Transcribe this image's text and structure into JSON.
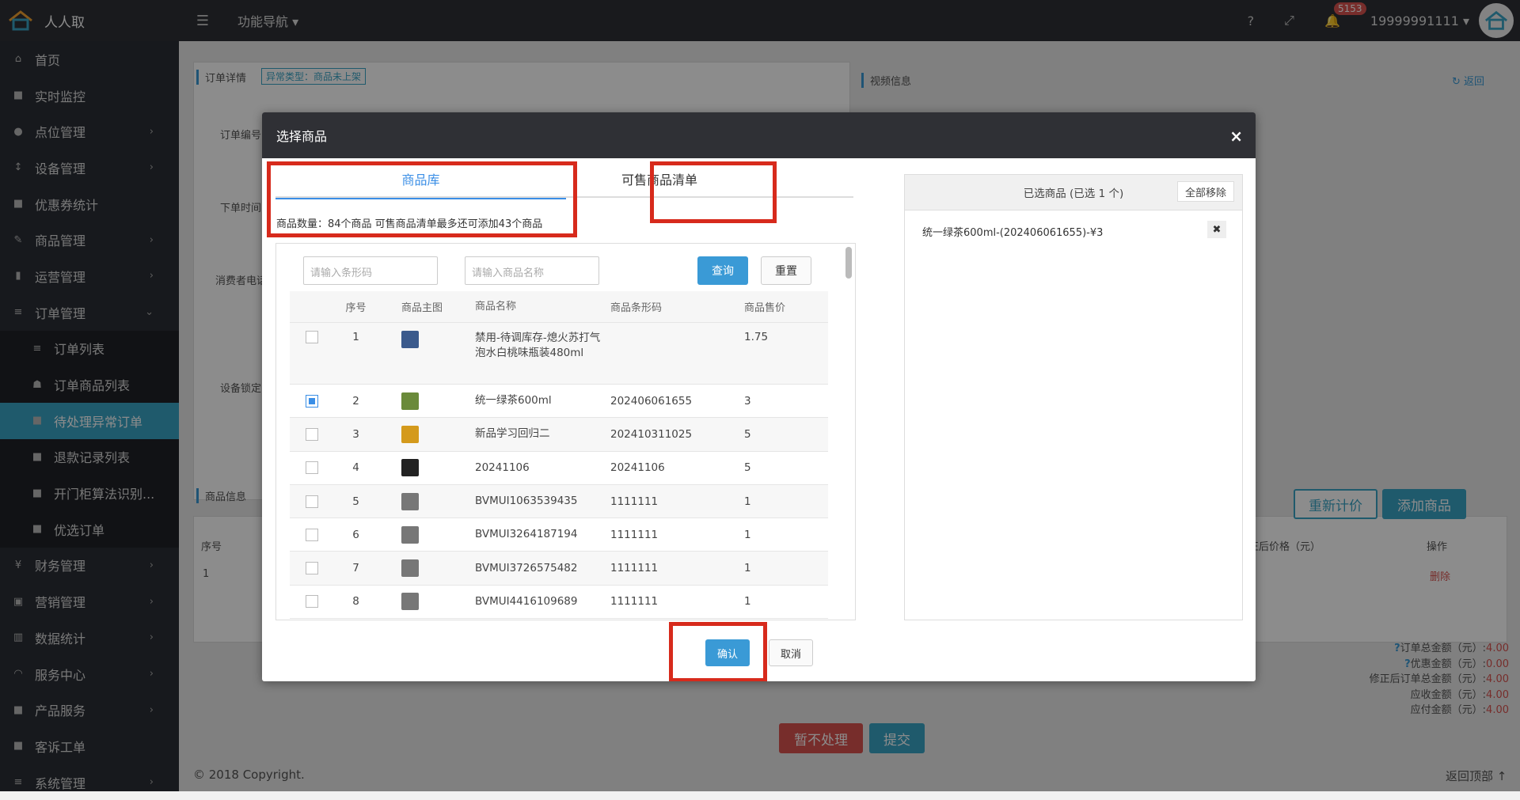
{
  "app": {
    "name": "人人取",
    "func_nav": "功能导航",
    "notify_count": "5153",
    "user": "19999991111",
    "help": "?",
    "expand": "⤢"
  },
  "sidebar": {
    "items": [
      {
        "label": "首页",
        "icon": "home-icon",
        "chev": false
      },
      {
        "label": "实时监控",
        "icon": "video-icon",
        "chev": false
      },
      {
        "label": "点位管理",
        "icon": "pin-icon",
        "chev": true
      },
      {
        "label": "设备管理",
        "icon": "sort-icon",
        "chev": true
      },
      {
        "label": "优惠券统计",
        "icon": "square-icon",
        "chev": false
      },
      {
        "label": "商品管理",
        "icon": "edit-icon",
        "chev": true
      },
      {
        "label": "运营管理",
        "icon": "bookmark-icon",
        "chev": true
      },
      {
        "label": "订单管理",
        "icon": "list-icon",
        "chev": true,
        "open": true
      },
      {
        "label": "订单列表",
        "icon": "menu-icon",
        "sub": true
      },
      {
        "label": "订单商品列表",
        "icon": "sitemap-icon",
        "sub": true
      },
      {
        "label": "待处理异常订单",
        "icon": "square-icon",
        "sub": true,
        "active": true
      },
      {
        "label": "退款记录列表",
        "icon": "square-icon",
        "sub": true
      },
      {
        "label": "开门柜算法识别...",
        "icon": "square-icon",
        "sub": true
      },
      {
        "label": "优选订单",
        "icon": "square-icon",
        "sub": true
      },
      {
        "label": "财务管理",
        "icon": "yen-icon",
        "chev": true
      },
      {
        "label": "营销管理",
        "icon": "shop-icon",
        "chev": true
      },
      {
        "label": "数据统计",
        "icon": "chart-icon",
        "chev": true
      },
      {
        "label": "服务中心",
        "icon": "headset-icon",
        "chev": true
      },
      {
        "label": "产品服务",
        "icon": "square-icon",
        "chev": true
      },
      {
        "label": "客诉工单",
        "icon": "square-icon",
        "chev": false
      },
      {
        "label": "系统管理",
        "icon": "list-icon",
        "chev": true
      }
    ]
  },
  "background": {
    "order_detail": "订单详情",
    "exception_tag": "异常类型：商品未上架",
    "video_info": "视频信息",
    "back": "返回",
    "order_no": "订单编号",
    "order_time": "下单时间",
    "consumer_phone": "消费者电话",
    "device_lock": "设备锁定",
    "goods_info": "商品信息",
    "recalc": "重新计价",
    "add_goods": "添加商品",
    "col_no": "序号",
    "col_price_after": "修正后价格（元）",
    "col_op": "操作",
    "row_no": "1",
    "delete": "删除",
    "totals": [
      {
        "label": "订单总金额（元）:",
        "value": "4.00",
        "q": true
      },
      {
        "label": "优惠金额（元）:",
        "value": "0.00",
        "q": true
      },
      {
        "label": "修正后订单总金额（元）:",
        "value": "4.00"
      },
      {
        "label": "应收金额（元）:",
        "value": "4.00"
      },
      {
        "label": "应付金额（元）:",
        "value": "4.00"
      }
    ],
    "no_process": "暂不处理",
    "submit": "提交",
    "copyright": "© 2018 Copyright.",
    "back_top": "返回顶部"
  },
  "modal": {
    "title": "选择商品",
    "close": "×",
    "tab_library": "商品库",
    "tab_sellable": "可售商品清单",
    "count_note": "商品数量：84个商品 可售商品清单最多还可添加43个商品",
    "barcode_placeholder": "请输入条形码",
    "name_placeholder": "请输入商品名称",
    "query": "查询",
    "reset": "重置",
    "headers": [
      "序号",
      "商品主图",
      "商品名称",
      "商品条形码",
      "商品售价"
    ],
    "rows": [
      {
        "no": "1",
        "name": "禁用-待调库存-熄火苏打气泡水白桃味瓶装480ml",
        "barcode": "",
        "price": "1.75",
        "checked": false,
        "color": "#3b5a8c"
      },
      {
        "no": "2",
        "name": "统一绿茶600ml",
        "barcode": "202406061655",
        "price": "3",
        "checked": true,
        "color": "#6a8a3a"
      },
      {
        "no": "3",
        "name": "新品学习回归二",
        "barcode": "202410311025",
        "price": "5",
        "checked": false,
        "color": "#d49a1c"
      },
      {
        "no": "4",
        "name": "20241106",
        "barcode": "20241106",
        "price": "5",
        "checked": false,
        "color": "#222222"
      },
      {
        "no": "5",
        "name": "BVMUI1063539435",
        "barcode": "1111111",
        "price": "1",
        "checked": false,
        "color": "#777777"
      },
      {
        "no": "6",
        "name": "BVMUI3264187194",
        "barcode": "1111111",
        "price": "1",
        "checked": false,
        "color": "#777777"
      },
      {
        "no": "7",
        "name": "BVMUI3726575482",
        "barcode": "1111111",
        "price": "1",
        "checked": false,
        "color": "#777777"
      },
      {
        "no": "8",
        "name": "BVMUI4416109689",
        "barcode": "1111111",
        "price": "1",
        "checked": false,
        "color": "#777777"
      }
    ],
    "selected_header": "已选商品 (已选 1 个)",
    "remove_all": "全部移除",
    "selected_item": "统一绿茶600ml-(202406061655)-¥3",
    "remove_x": "✖",
    "confirm": "确认",
    "cancel": "取消"
  },
  "colors": {
    "accent": "#3a9ad6",
    "highlight": "#d72a1c",
    "active_nav": "#3aa4c5"
  }
}
